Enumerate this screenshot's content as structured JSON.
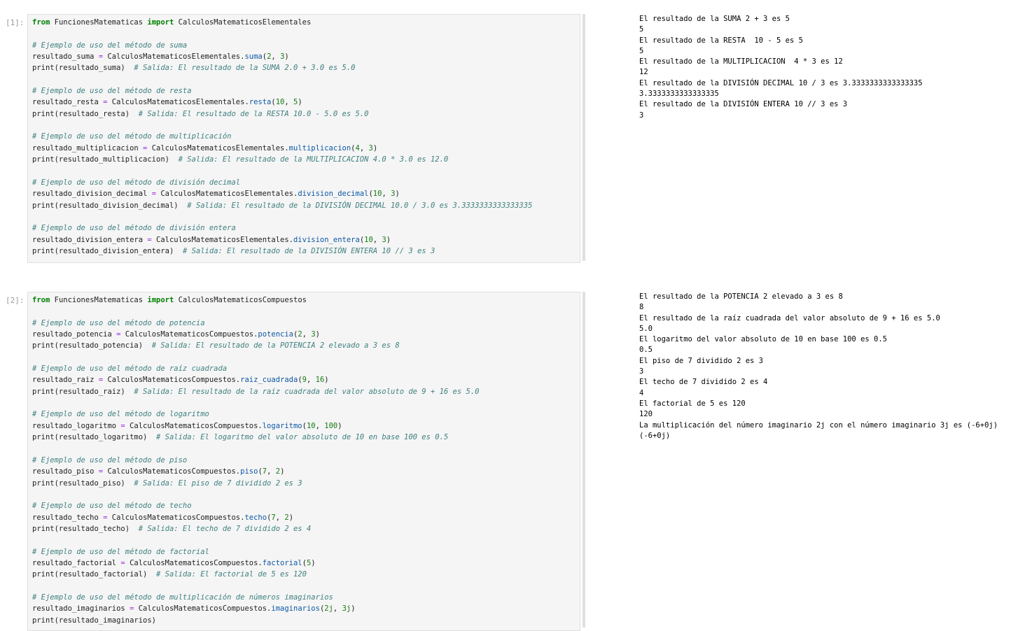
{
  "cells": [
    {
      "prompt": "[1]:",
      "code": {
        "import": {
          "from": "from",
          "module": "FuncionesMatematicas",
          "import": "import",
          "cls": "CalculosMatematicosElementales"
        },
        "blocks": [
          {
            "comment": "# Ejemplo de uso del método de suma",
            "var": "resultado_suma",
            "eq": " = ",
            "cls": "CalculosMatematicosElementales.",
            "method": "suma",
            "a": "2",
            "b": "3",
            "print_pre": "print(resultado_suma)",
            "print_comment": "  # Salida: El resultado de la SUMA 2.0 + 3.0 es 5.0"
          },
          {
            "comment": "# Ejemplo de uso del método de resta",
            "var": "resultado_resta",
            "eq": " = ",
            "cls": "CalculosMatematicosElementales.",
            "method": "resta",
            "a": "10",
            "b": "5",
            "print_pre": "print(resultado_resta)",
            "print_comment": "  # Salida: El resultado de la RESTA 10.0 - 5.0 es 5.0"
          },
          {
            "comment": "# Ejemplo de uso del método de multiplicación",
            "var": "resultado_multiplicacion",
            "eq": " = ",
            "cls": "CalculosMatematicosElementales.",
            "method": "multiplicacion",
            "a": "4",
            "b": "3",
            "print_pre": "print(resultado_multiplicacion)",
            "print_comment": "  # Salida: El resultado de la MULTIPLICACION 4.0 * 3.0 es 12.0"
          },
          {
            "comment": "# Ejemplo de uso del método de división decimal",
            "var": "resultado_division_decimal",
            "eq": " = ",
            "cls": "CalculosMatematicosElementales.",
            "method": "division_decimal",
            "a": "10",
            "b": "3",
            "print_pre": "print(resultado_division_decimal)",
            "print_comment": "  # Salida: El resultado de la DIVISIÓN DECIMAL 10.0 / 3.0 es 3.3333333333333335"
          },
          {
            "comment": "# Ejemplo de uso del método de división entera",
            "var": "resultado_division_entera",
            "eq": " = ",
            "cls": "CalculosMatematicosElementales.",
            "method": "division_entera",
            "a": "10",
            "b": "3",
            "print_pre": "print(resultado_division_entera)",
            "print_comment": "  # Salida: El resultado de la DIVISIÓN ENTERA 10 // 3 es 3"
          }
        ]
      },
      "output": [
        "El resultado de la SUMA 2 + 3 es 5",
        "5",
        "El resultado de la RESTA  10 - 5 es 5",
        "5",
        "El resultado de la MULTIPLICACION  4 * 3 es 12",
        "12",
        "El resultado de la DIVISIÓN DECIMAL 10 / 3 es 3.3333333333333335",
        "3.3333333333333335",
        "El resultado de la DIVISIÓN ENTERA 10 // 3 es 3",
        "3"
      ]
    },
    {
      "prompt": "[2]:",
      "code": {
        "import": {
          "from": "from",
          "module": "FuncionesMatematicas",
          "import": "import",
          "cls": "CalculosMatematicosCompuestos"
        },
        "blocks": [
          {
            "comment": "# Ejemplo de uso del método de potencia",
            "var": "resultado_potencia",
            "eq": " = ",
            "cls": "CalculosMatematicosCompuestos.",
            "method": "potencia",
            "a": "2",
            "b": "3",
            "print_pre": "print(resultado_potencia)",
            "print_comment": "  # Salida: El resultado de la POTENCIA 2 elevado a 3 es 8"
          },
          {
            "comment": "# Ejemplo de uso del método de raíz cuadrada",
            "var": "resultado_raiz",
            "eq": " = ",
            "cls": "CalculosMatematicosCompuestos.",
            "method": "raiz_cuadrada",
            "a": "9",
            "b": "16",
            "print_pre": "print(resultado_raiz)",
            "print_comment": "  # Salida: El resultado de la raíz cuadrada del valor absoluto de 9 + 16 es 5.0"
          },
          {
            "comment": "# Ejemplo de uso del método de logaritmo",
            "var": "resultado_logaritmo",
            "eq": " = ",
            "cls": "CalculosMatematicosCompuestos.",
            "method": "logaritmo",
            "a": "10",
            "b": "100",
            "print_pre": "print(resultado_logaritmo)",
            "print_comment": "  # Salida: El logaritmo del valor absoluto de 10 en base 100 es 0.5"
          },
          {
            "comment": "# Ejemplo de uso del método de piso",
            "var": "resultado_piso",
            "eq": " = ",
            "cls": "CalculosMatematicosCompuestos.",
            "method": "piso",
            "a": "7",
            "b": "2",
            "print_pre": "print(resultado_piso)",
            "print_comment": "  # Salida: El piso de 7 dividido 2 es 3"
          },
          {
            "comment": "# Ejemplo de uso del método de techo",
            "var": "resultado_techo",
            "eq": " = ",
            "cls": "CalculosMatematicosCompuestos.",
            "method": "techo",
            "a": "7",
            "b": "2",
            "print_pre": "print(resultado_techo)",
            "print_comment": "  # Salida: El techo de 7 dividido 2 es 4"
          },
          {
            "comment": "# Ejemplo de uso del método de factorial",
            "var": "resultado_factorial",
            "eq": " = ",
            "cls": "CalculosMatematicosCompuestos.",
            "method": "factorial",
            "a": "5",
            "b": "",
            "print_pre": "print(resultado_factorial)",
            "print_comment": "  # Salida: El factorial de 5 es 120"
          },
          {
            "comment": "# Ejemplo de uso del método de multiplicación de números imaginarios",
            "var": "resultado_imaginarios",
            "eq": " = ",
            "cls": "CalculosMatematicosCompuestos.",
            "method": "imaginarios",
            "a": "2j",
            "b": "3j",
            "print_pre": "print(resultado_imaginarios)",
            "print_comment": ""
          }
        ]
      },
      "output": [
        "El resultado de la POTENCIA 2 elevado a 3 es 8",
        "8",
        "El resultado de la raíz cuadrada del valor absoluto de 9 + 16 es 5.0",
        "5.0",
        "El logaritmo del valor absoluto de 10 en base 100 es 0.5",
        "0.5",
        "El piso de 7 dividido 2 es 3",
        "3",
        "El techo de 7 dividido 2 es 4",
        "4",
        "El factorial de 5 es 120",
        "120",
        "La multiplicación del número imaginario 2j con el número imaginario 3j es (-6+0j)",
        "(-6+0j)"
      ]
    }
  ]
}
